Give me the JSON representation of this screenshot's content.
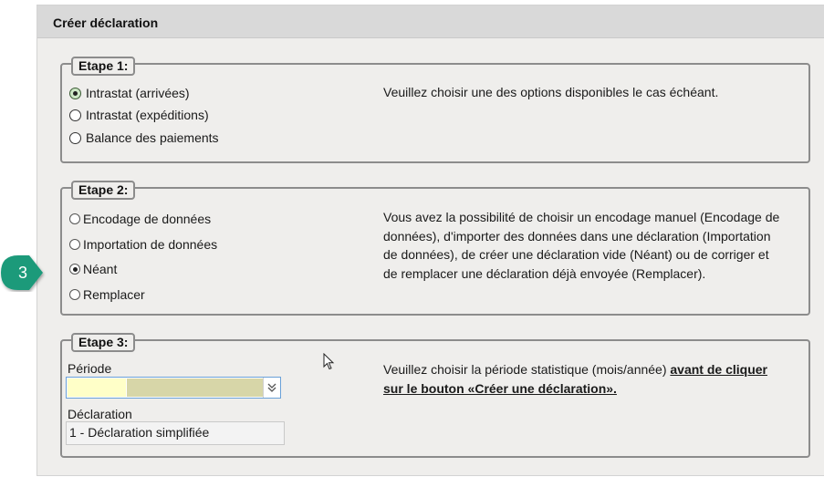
{
  "panel": {
    "title": "Créer déclaration"
  },
  "step1": {
    "legend": "Etape 1:",
    "options": [
      {
        "label": "Intrastat (arrivées)",
        "selected": true
      },
      {
        "label": "Intrastat (expéditions)",
        "selected": false
      },
      {
        "label": "Balance des paiements",
        "selected": false
      }
    ],
    "description": "Veuillez choisir une des options disponibles le cas échéant."
  },
  "step2": {
    "legend": "Etape 2:",
    "options": [
      {
        "label": "Encodage de données",
        "selected": false
      },
      {
        "label": "Importation de données",
        "selected": false
      },
      {
        "label": "Néant",
        "selected": true
      },
      {
        "label": "Remplacer",
        "selected": false
      }
    ],
    "description": [
      "Vous avez la possibilité de choisir un encodage manuel (Encodage de",
      "données), d'importer des données dans une déclaration (Importation",
      "de données), de créer une déclaration vide (Néant) ou de corriger et",
      "de remplacer une déclaration déjà envoyée (Remplacer)."
    ]
  },
  "step3": {
    "legend": "Etape 3:",
    "period_label": "Période",
    "period_value": "",
    "declaration_label": "Déclaration",
    "declaration_value": "1 - Déclaration simplifiée",
    "description_line1_normal": "Veuillez choisir la période statistique (mois/année)",
    "description_line1_bold": "avant de cliquer",
    "description_line2_bold": "sur le bouton «Créer une déclaration»."
  },
  "annotation": {
    "step_number": "3",
    "color": "#1a9a7a"
  },
  "colors": {
    "panel_bg": "#efeeec",
    "header_bg": "#d9d9d9",
    "select_border": "#6aa1d8"
  }
}
